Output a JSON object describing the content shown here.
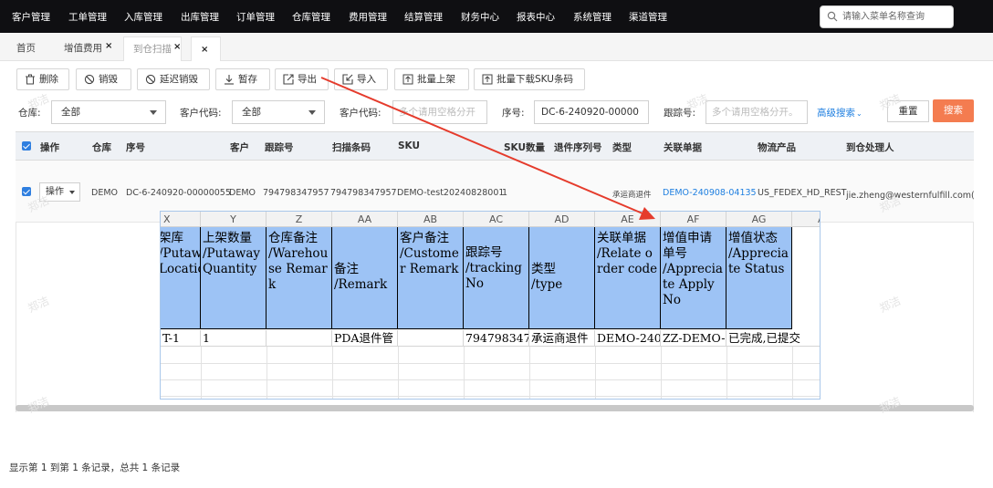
{
  "topnav": {
    "items": [
      "客户管理",
      "工单管理",
      "入库管理",
      "出库管理",
      "订单管理",
      "仓库管理",
      "费用管理",
      "结算管理",
      "财务中心",
      "报表中心",
      "系统管理",
      "渠道管理"
    ],
    "search_placeholder": "请输入菜单名称查询"
  },
  "tabs": [
    {
      "label": "首页"
    },
    {
      "label": "增值费用"
    },
    {
      "label": "到仓扫描"
    }
  ],
  "tab_close": "×",
  "toolbar": {
    "buttons": [
      "删除",
      "销毁",
      "延迟销毁",
      "暂存",
      "导出",
      "导入",
      "批量上架",
      "批量下载SKU条码"
    ]
  },
  "filters": {
    "warehouse_label": "仓库:",
    "warehouse_value": "全部",
    "customer_code_label": "客户代码:",
    "customer_code_value": "全部",
    "customer_code2_label": "客户代码:",
    "customer_code2_placeholder": "多个请用空格分开",
    "seq_label": "序号:",
    "seq_value": "DC-6-240920-00000",
    "tracking_label": "跟踪号:",
    "tracking_placeholder": "多个请用空格分开。",
    "advanced_search": "高级搜索",
    "reset": "重置",
    "search": "搜索"
  },
  "table": {
    "headers": [
      "操作",
      "仓库",
      "序号",
      "客户",
      "跟踪号",
      "扫描条码",
      "SKU",
      "SKU数量",
      "退件序列号",
      "类型",
      "关联单据",
      "物流产品",
      "到仓处理人"
    ],
    "row": {
      "action": "操作",
      "warehouse": "DEMO",
      "seq": "DC-6-240920-00000055",
      "customer": "DEMO",
      "tracking": "794798347957",
      "scan_code": "794798347957",
      "sku": "DEMO-test20240828001",
      "sku_qty": "1",
      "type": "承运商退件",
      "related_doc": "DEMO-240908-04135",
      "logistics": "US_FEDEX_HD_REST",
      "handler": "jie.zheng@westernfulfill.com(郑洁"
    }
  },
  "spreadsheet": {
    "columns": [
      "X",
      "Y",
      "Z",
      "AA",
      "AB",
      "AC",
      "AD",
      "AE",
      "AF",
      "AG",
      "A"
    ],
    "headers": [
      "架库\n/Putawa\nLocatio",
      "上架数量\n/Putaway Quantity",
      "仓库备注\n/Warehouse Remark",
      "备注\n/Remark",
      "客户备注\n/Customer Remark",
      "跟踪号\n/trackingNo",
      "类型\n/type",
      "关联单据\n/Relate order code",
      "增值申请单号\n/Appreciate Apply No",
      "增值状态\n/Appreciate Status"
    ],
    "row": [
      "T-1",
      "1",
      "",
      "PDA退件管",
      "",
      "794798347",
      "承运商退件",
      "DEMO-2409",
      "ZZ-DEMO-6",
      "已完成,已提交"
    ]
  },
  "footer": "显示第 1 到第 1 条记录，总共 1 条记录",
  "watermark": "郑洁",
  "colors": {
    "nav_bg": "#0f0f12",
    "search_btn": "#f47c50",
    "header_fill": "#9dc3f5",
    "arrow": "#e53b2c",
    "link": "#1f7fe0"
  }
}
